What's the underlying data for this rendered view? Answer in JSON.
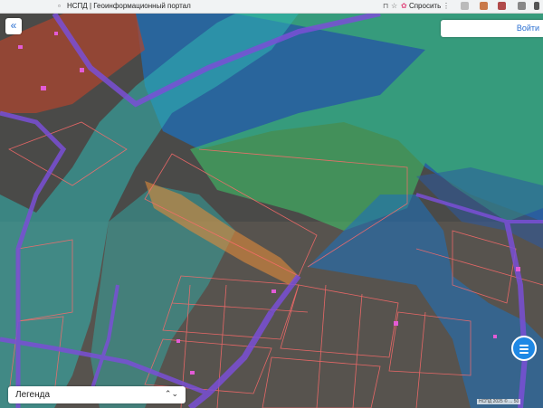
{
  "browser": {
    "tab_title": "НСПД | Геоинформационный портал",
    "ask_label": "Спросить"
  },
  "map_controls": {
    "collapse_label": "«",
    "login_label": "Войти",
    "legend_label": "Легенда",
    "legend_chevron": "⌃⌄",
    "scale_label": "НСПД 2025 © ... 50"
  },
  "colors": {
    "zone_teal": "#2fb6b2",
    "zone_green": "#3fbf67",
    "zone_blue": "#1f6fb8",
    "road_purple": "#7a4fd6",
    "parcel_border": "#ff6b6b",
    "orange_zone": "#e08a3a",
    "chat_button": "#1e88e5"
  },
  "icons": [
    "bookmark-icon",
    "star-icon",
    "ask-icon",
    "more-icon",
    "chat-icon",
    "collapse-icon"
  ]
}
